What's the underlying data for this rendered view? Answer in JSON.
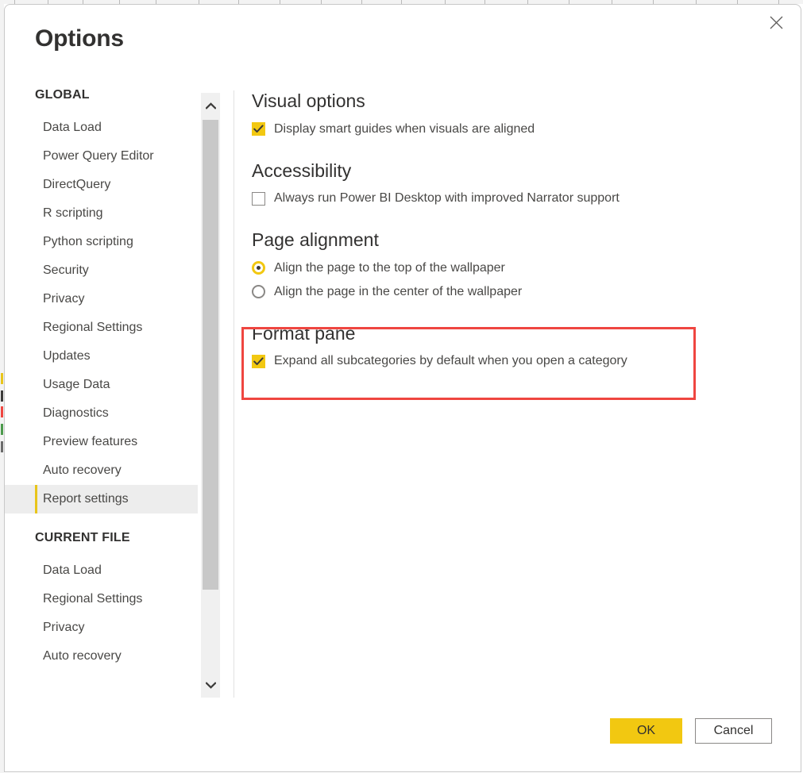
{
  "dialog": {
    "title": "Options",
    "close_icon": "close-icon"
  },
  "sidebar": {
    "groups": [
      {
        "label": "GLOBAL",
        "items": [
          {
            "label": "Data Load",
            "selected": false
          },
          {
            "label": "Power Query Editor",
            "selected": false
          },
          {
            "label": "DirectQuery",
            "selected": false
          },
          {
            "label": "R scripting",
            "selected": false
          },
          {
            "label": "Python scripting",
            "selected": false
          },
          {
            "label": "Security",
            "selected": false
          },
          {
            "label": "Privacy",
            "selected": false
          },
          {
            "label": "Regional Settings",
            "selected": false
          },
          {
            "label": "Updates",
            "selected": false
          },
          {
            "label": "Usage Data",
            "selected": false
          },
          {
            "label": "Diagnostics",
            "selected": false
          },
          {
            "label": "Preview features",
            "selected": false
          },
          {
            "label": "Auto recovery",
            "selected": false
          },
          {
            "label": "Report settings",
            "selected": true
          }
        ]
      },
      {
        "label": "CURRENT FILE",
        "items": [
          {
            "label": "Data Load",
            "selected": false
          },
          {
            "label": "Regional Settings",
            "selected": false
          },
          {
            "label": "Privacy",
            "selected": false
          },
          {
            "label": "Auto recovery",
            "selected": false
          }
        ]
      }
    ],
    "scrollbar": {
      "up_arrow_icon": "chevron-up-icon",
      "down_arrow_icon": "chevron-down-icon"
    }
  },
  "content": {
    "sections": [
      {
        "heading": "Visual options",
        "controls": [
          {
            "type": "checkbox",
            "checked": true,
            "label": "Display smart guides when visuals are aligned"
          }
        ]
      },
      {
        "heading": "Accessibility",
        "controls": [
          {
            "type": "checkbox",
            "checked": false,
            "label": "Always run Power BI Desktop with improved Narrator support"
          }
        ]
      },
      {
        "heading": "Page alignment",
        "controls": [
          {
            "type": "radio",
            "checked": true,
            "label": "Align the page to the top of the wallpaper"
          },
          {
            "type": "radio",
            "checked": false,
            "label": "Align the page in the center of the wallpaper"
          }
        ]
      },
      {
        "heading": "Format pane",
        "highlighted": true,
        "controls": [
          {
            "type": "checkbox",
            "checked": true,
            "label": "Expand all subcategories by default when you open a category"
          }
        ]
      }
    ]
  },
  "footer": {
    "ok_label": "OK",
    "cancel_label": "Cancel"
  },
  "colors": {
    "accent_yellow": "#f2c811",
    "selection_bar": "#e8c51b",
    "annotation_red": "#ef4640",
    "text": "#494846",
    "heading": "#323130"
  }
}
